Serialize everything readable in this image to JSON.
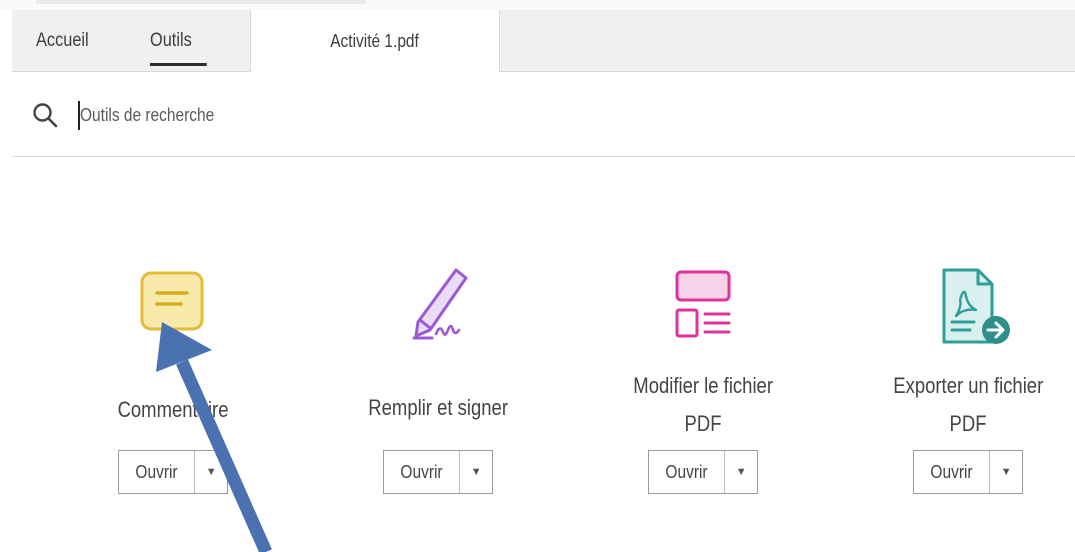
{
  "tabs": {
    "home": "Accueil",
    "tools": "Outils",
    "document": "Activité 1.pdf"
  },
  "search": {
    "placeholder": "Outils de recherche"
  },
  "tools": [
    {
      "label": "Commentaire",
      "open": "Ouvrir",
      "icon": "comment-icon",
      "color": "#e8c33a"
    },
    {
      "label": "Remplir et signer",
      "open": "Ouvrir",
      "icon": "fill-sign-icon",
      "color": "#9b59d6"
    },
    {
      "label_line1": "Modifier le fichier",
      "label_line2": "PDF",
      "open": "Ouvrir",
      "icon": "edit-pdf-icon",
      "color": "#e0329b"
    },
    {
      "label_line1": "Exporter un fichier",
      "label_line2": "PDF",
      "open": "Ouvrir",
      "icon": "export-pdf-icon",
      "color": "#2e9e9a"
    }
  ],
  "annotation": {
    "icon": "pointer-arrow-icon",
    "color": "#4a72b0"
  }
}
